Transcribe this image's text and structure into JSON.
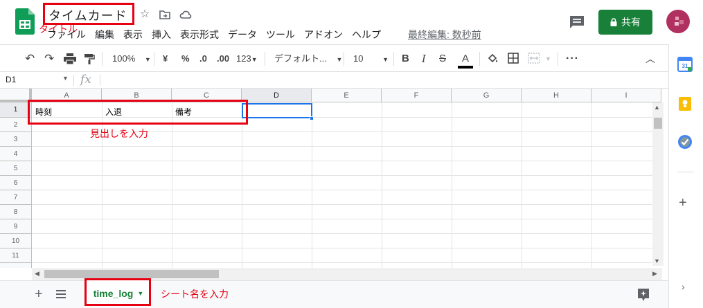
{
  "doc": {
    "title": "タイムカード",
    "last_edit": "最終編集: 数秒前"
  },
  "menu": [
    "ファイル",
    "編集",
    "表示",
    "挿入",
    "表示形式",
    "データ",
    "ツール",
    "アドオン",
    "ヘルプ"
  ],
  "share": {
    "label": "共有"
  },
  "toolbar": {
    "zoom": "100%",
    "currency": "¥",
    "percent": "%",
    "dec_decrease": ".0",
    "dec_increase": ".00",
    "format_more": "123",
    "font": "デフォルト...",
    "font_size": "10"
  },
  "formula_bar": {
    "cell_ref": "D1",
    "fx": "fx"
  },
  "columns": [
    "A",
    "B",
    "C",
    "D",
    "E",
    "F",
    "G",
    "H",
    "I"
  ],
  "rows": [
    "1",
    "2",
    "3",
    "4",
    "5",
    "6",
    "7",
    "8",
    "9",
    "10",
    "11"
  ],
  "cells": {
    "A1": "時刻",
    "B1": "入退",
    "C1": "備考"
  },
  "annotations": {
    "title": "タイトル",
    "headers": "見出しを入力",
    "sheet": "シート名を入力"
  },
  "sheet": {
    "name": "time_log"
  },
  "colors": {
    "accent": "#188038",
    "annotation": "#e60012",
    "selection": "#1a73e8"
  },
  "side_icons": [
    "calendar-icon",
    "keep-icon",
    "tasks-icon",
    "add-icon"
  ]
}
